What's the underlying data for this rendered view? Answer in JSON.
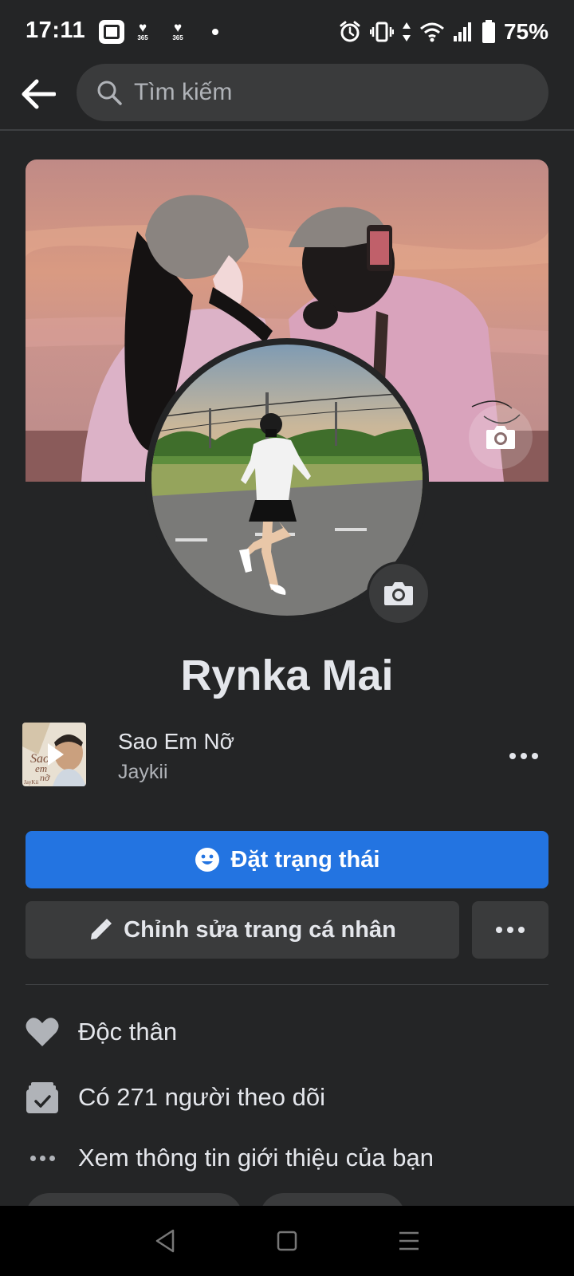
{
  "status_bar": {
    "time": "17:11",
    "app_badge_1": "365",
    "app_badge_2": "365",
    "battery": "75%"
  },
  "search": {
    "placeholder": "Tìm kiếm"
  },
  "profile": {
    "name": "Rynka Mai"
  },
  "music": {
    "song_title": "Sao Em Nỡ",
    "artist": "Jaykii",
    "album_art_text_1": "Sao",
    "album_art_text_2": "em",
    "album_art_text_3": "nỡ",
    "album_art_signature": "JayKii"
  },
  "actions": {
    "set_status_label": "Đặt trạng thái",
    "edit_profile_label": "Chỉnh sửa trang cá nhân"
  },
  "details": {
    "relationship": "Độc thân",
    "followers": "Có 271 người theo dõi",
    "see_about": "Xem thông tin giới thiệu của bạn"
  },
  "colors": {
    "background": "#242526",
    "surface": "#3a3b3c",
    "primary": "#2374e1",
    "text": "#e4e6eb",
    "secondary_text": "#b0b3b8"
  }
}
